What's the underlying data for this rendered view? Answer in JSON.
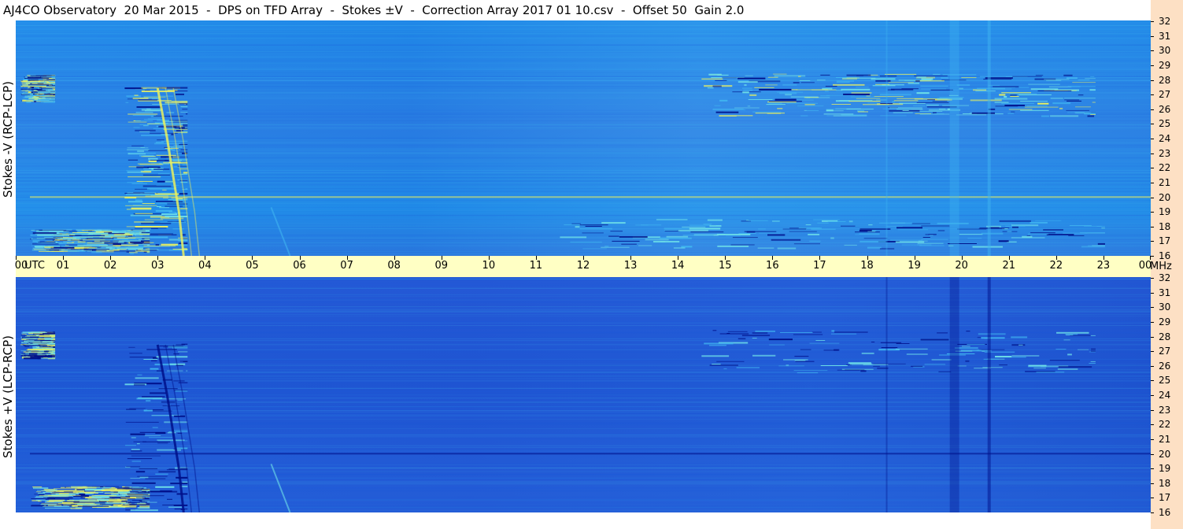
{
  "title": "AJ4CO Observatory  20 Mar 2015  -  DPS on TFD Array  -  Stokes ±V  -  Correction Array 2017 01 10.csv  -  Offset 50  Gain 2.0",
  "chart_data": [
    {
      "type": "heatmap",
      "ylabel": "Stokes -V (RCP-LCP)",
      "ylim": [
        16,
        32
      ],
      "yticks": [
        16,
        17,
        18,
        19,
        20,
        21,
        22,
        23,
        24,
        25,
        26,
        27,
        28,
        29,
        30,
        31,
        32
      ],
      "colormap": [
        "#00108a",
        "#1a5adc",
        "#2f84e6",
        "#40b4f0",
        "#6ee0e8",
        "#e8f060",
        "#ff3030"
      ],
      "features": [
        {
          "name": "",
          "x": [
            0.1,
            0.8
          ],
          "y": [
            26.5,
            28.3
          ],
          "intensity": "high"
        },
        {
          "name": "",
          "x": [
            14.5,
            22.8
          ],
          "y": [
            25.5,
            28.4
          ],
          "intensity": "high"
        },
        {
          "name": "",
          "x": [
            2.3,
            3.6
          ],
          "y": [
            16.2,
            27.5
          ],
          "intensity": "high"
        },
        {
          "name": "",
          "x": [
            0.3,
            2.8
          ],
          "y": [
            16.3,
            17.8
          ],
          "intensity": "high"
        },
        {
          "name": "",
          "x": [
            11.5,
            23.0
          ],
          "y": [
            16.5,
            18.5
          ],
          "intensity": "medium"
        }
      ]
    },
    {
      "type": "heatmap",
      "ylabel": "Stokes +V (LCP-RCP)",
      "ylim": [
        16,
        32
      ],
      "yticks": [
        16,
        17,
        18,
        19,
        20,
        21,
        22,
        23,
        24,
        25,
        26,
        27,
        28,
        29,
        30,
        31,
        32
      ],
      "colormap": [
        "#00108a",
        "#1a5adc",
        "#2f84e6",
        "#40b4f0",
        "#6ee0e8",
        "#e8f060",
        "#ff3030"
      ],
      "features": [
        {
          "name": "",
          "x": [
            0.1,
            0.8
          ],
          "y": [
            26.5,
            28.3
          ],
          "intensity": "high"
        },
        {
          "name": "",
          "x": [
            14.5,
            22.8
          ],
          "y": [
            25.5,
            28.4
          ],
          "intensity": "low"
        },
        {
          "name": "",
          "x": [
            2.3,
            3.6
          ],
          "y": [
            16.2,
            27.5
          ],
          "intensity": "low"
        },
        {
          "name": "",
          "x": [
            0.3,
            2.8
          ],
          "y": [
            16.3,
            17.8
          ],
          "intensity": "high"
        }
      ]
    }
  ],
  "time_axis": {
    "xlim": [
      0,
      24
    ],
    "ticks": [
      "00",
      "01",
      "02",
      "03",
      "04",
      "05",
      "06",
      "07",
      "08",
      "09",
      "10",
      "11",
      "12",
      "13",
      "14",
      "15",
      "16",
      "17",
      "18",
      "19",
      "20",
      "21",
      "22",
      "23",
      "00"
    ],
    "unit_label": "UTC",
    "freq_unit": "MHz"
  }
}
